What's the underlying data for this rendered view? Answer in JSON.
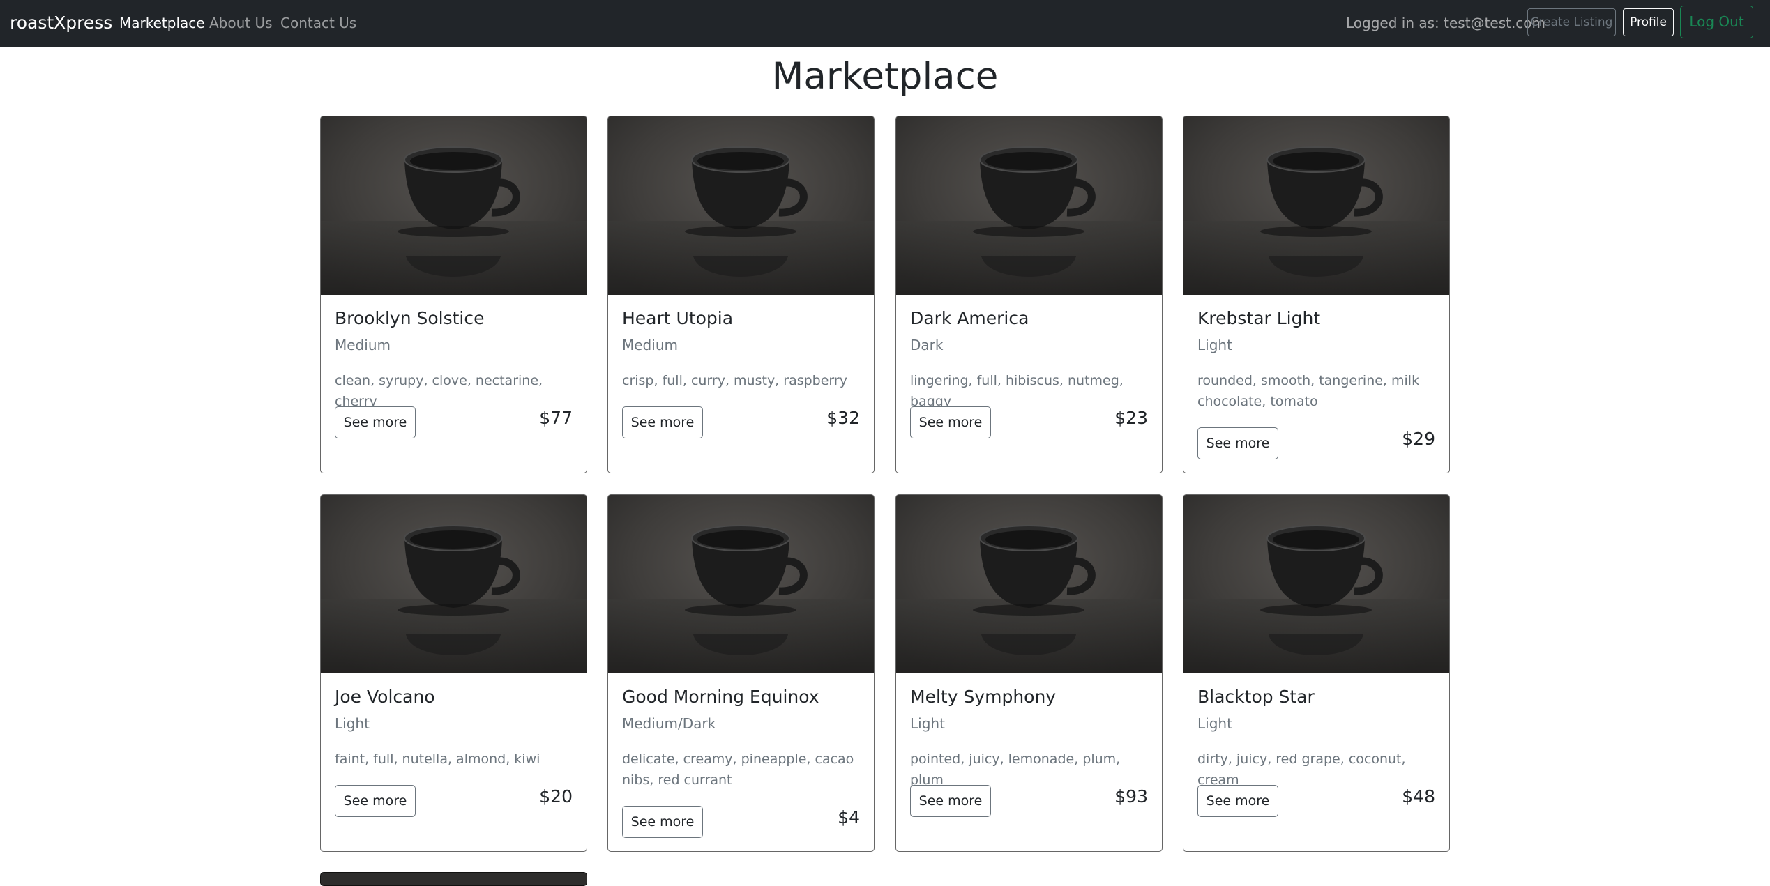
{
  "navbar": {
    "brand": "roastXpress",
    "links": [
      {
        "label": "Marketplace",
        "active": true
      },
      {
        "label": "About Us",
        "active": false
      },
      {
        "label": "Contact Us",
        "active": false
      }
    ],
    "logged_in_text": "Logged in as: test@test.com",
    "create_listing_label": "Create Listing",
    "profile_label": "Profile",
    "logout_label": "Log Out"
  },
  "page": {
    "title": "Marketplace"
  },
  "colors": {
    "navbar_bg": "#212529",
    "logout_accent": "#198754",
    "muted_text": "#6c757d"
  },
  "listings": [
    {
      "name": "Brooklyn Solstice",
      "roast": "Medium",
      "notes": "clean, syrupy, clove, nectarine, cherry",
      "price": "$77",
      "button_label": "See more",
      "image": "coffee-cup-image"
    },
    {
      "name": "Heart Utopia",
      "roast": "Medium",
      "notes": "crisp, full, curry, musty, raspberry",
      "price": "$32",
      "button_label": "See more",
      "image": "coffee-cup-image"
    },
    {
      "name": "Dark America",
      "roast": "Dark",
      "notes": "lingering, full, hibiscus, nutmeg, baggy",
      "price": "$23",
      "button_label": "See more",
      "image": "coffee-cup-image"
    },
    {
      "name": "Krebstar Light",
      "roast": "Light",
      "notes": "rounded, smooth, tangerine, milk chocolate, tomato",
      "price": "$29",
      "button_label": "See more",
      "image": "coffee-cup-image"
    },
    {
      "name": "Joe Volcano",
      "roast": "Light",
      "notes": "faint, full, nutella, almond, kiwi",
      "price": "$20",
      "button_label": "See more",
      "image": "coffee-cup-image"
    },
    {
      "name": "Good Morning Equinox",
      "roast": "Medium/Dark",
      "notes": "delicate, creamy, pineapple, cacao nibs, red currant",
      "price": "$4",
      "button_label": "See more",
      "image": "coffee-cup-image"
    },
    {
      "name": "Melty Symphony",
      "roast": "Light",
      "notes": "pointed, juicy, lemonade, plum, plum",
      "price": "$93",
      "button_label": "See more",
      "image": "coffee-cup-image"
    },
    {
      "name": "Blacktop Star",
      "roast": "Light",
      "notes": "dirty, juicy, red grape, coconut, cream",
      "price": "$48",
      "button_label": "See more",
      "image": "coffee-cup-image"
    }
  ]
}
